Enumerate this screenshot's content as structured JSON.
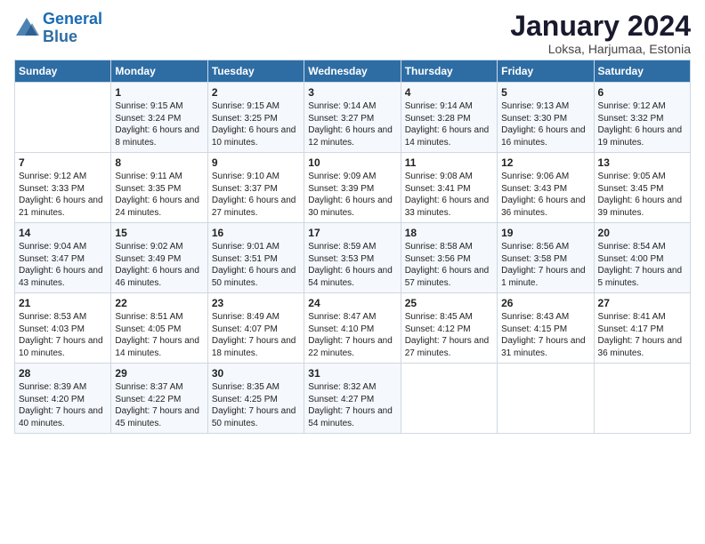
{
  "logo": {
    "line1": "General",
    "line2": "Blue"
  },
  "title": "January 2024",
  "subtitle": "Loksa, Harjumaa, Estonia",
  "days_of_week": [
    "Sunday",
    "Monday",
    "Tuesday",
    "Wednesday",
    "Thursday",
    "Friday",
    "Saturday"
  ],
  "weeks": [
    [
      {
        "day": "",
        "sunrise": "",
        "sunset": "",
        "daylight": ""
      },
      {
        "day": "1",
        "sunrise": "Sunrise: 9:15 AM",
        "sunset": "Sunset: 3:24 PM",
        "daylight": "Daylight: 6 hours and 8 minutes."
      },
      {
        "day": "2",
        "sunrise": "Sunrise: 9:15 AM",
        "sunset": "Sunset: 3:25 PM",
        "daylight": "Daylight: 6 hours and 10 minutes."
      },
      {
        "day": "3",
        "sunrise": "Sunrise: 9:14 AM",
        "sunset": "Sunset: 3:27 PM",
        "daylight": "Daylight: 6 hours and 12 minutes."
      },
      {
        "day": "4",
        "sunrise": "Sunrise: 9:14 AM",
        "sunset": "Sunset: 3:28 PM",
        "daylight": "Daylight: 6 hours and 14 minutes."
      },
      {
        "day": "5",
        "sunrise": "Sunrise: 9:13 AM",
        "sunset": "Sunset: 3:30 PM",
        "daylight": "Daylight: 6 hours and 16 minutes."
      },
      {
        "day": "6",
        "sunrise": "Sunrise: 9:12 AM",
        "sunset": "Sunset: 3:32 PM",
        "daylight": "Daylight: 6 hours and 19 minutes."
      }
    ],
    [
      {
        "day": "7",
        "sunrise": "Sunrise: 9:12 AM",
        "sunset": "Sunset: 3:33 PM",
        "daylight": "Daylight: 6 hours and 21 minutes."
      },
      {
        "day": "8",
        "sunrise": "Sunrise: 9:11 AM",
        "sunset": "Sunset: 3:35 PM",
        "daylight": "Daylight: 6 hours and 24 minutes."
      },
      {
        "day": "9",
        "sunrise": "Sunrise: 9:10 AM",
        "sunset": "Sunset: 3:37 PM",
        "daylight": "Daylight: 6 hours and 27 minutes."
      },
      {
        "day": "10",
        "sunrise": "Sunrise: 9:09 AM",
        "sunset": "Sunset: 3:39 PM",
        "daylight": "Daylight: 6 hours and 30 minutes."
      },
      {
        "day": "11",
        "sunrise": "Sunrise: 9:08 AM",
        "sunset": "Sunset: 3:41 PM",
        "daylight": "Daylight: 6 hours and 33 minutes."
      },
      {
        "day": "12",
        "sunrise": "Sunrise: 9:06 AM",
        "sunset": "Sunset: 3:43 PM",
        "daylight": "Daylight: 6 hours and 36 minutes."
      },
      {
        "day": "13",
        "sunrise": "Sunrise: 9:05 AM",
        "sunset": "Sunset: 3:45 PM",
        "daylight": "Daylight: 6 hours and 39 minutes."
      }
    ],
    [
      {
        "day": "14",
        "sunrise": "Sunrise: 9:04 AM",
        "sunset": "Sunset: 3:47 PM",
        "daylight": "Daylight: 6 hours and 43 minutes."
      },
      {
        "day": "15",
        "sunrise": "Sunrise: 9:02 AM",
        "sunset": "Sunset: 3:49 PM",
        "daylight": "Daylight: 6 hours and 46 minutes."
      },
      {
        "day": "16",
        "sunrise": "Sunrise: 9:01 AM",
        "sunset": "Sunset: 3:51 PM",
        "daylight": "Daylight: 6 hours and 50 minutes."
      },
      {
        "day": "17",
        "sunrise": "Sunrise: 8:59 AM",
        "sunset": "Sunset: 3:53 PM",
        "daylight": "Daylight: 6 hours and 54 minutes."
      },
      {
        "day": "18",
        "sunrise": "Sunrise: 8:58 AM",
        "sunset": "Sunset: 3:56 PM",
        "daylight": "Daylight: 6 hours and 57 minutes."
      },
      {
        "day": "19",
        "sunrise": "Sunrise: 8:56 AM",
        "sunset": "Sunset: 3:58 PM",
        "daylight": "Daylight: 7 hours and 1 minute."
      },
      {
        "day": "20",
        "sunrise": "Sunrise: 8:54 AM",
        "sunset": "Sunset: 4:00 PM",
        "daylight": "Daylight: 7 hours and 5 minutes."
      }
    ],
    [
      {
        "day": "21",
        "sunrise": "Sunrise: 8:53 AM",
        "sunset": "Sunset: 4:03 PM",
        "daylight": "Daylight: 7 hours and 10 minutes."
      },
      {
        "day": "22",
        "sunrise": "Sunrise: 8:51 AM",
        "sunset": "Sunset: 4:05 PM",
        "daylight": "Daylight: 7 hours and 14 minutes."
      },
      {
        "day": "23",
        "sunrise": "Sunrise: 8:49 AM",
        "sunset": "Sunset: 4:07 PM",
        "daylight": "Daylight: 7 hours and 18 minutes."
      },
      {
        "day": "24",
        "sunrise": "Sunrise: 8:47 AM",
        "sunset": "Sunset: 4:10 PM",
        "daylight": "Daylight: 7 hours and 22 minutes."
      },
      {
        "day": "25",
        "sunrise": "Sunrise: 8:45 AM",
        "sunset": "Sunset: 4:12 PM",
        "daylight": "Daylight: 7 hours and 27 minutes."
      },
      {
        "day": "26",
        "sunrise": "Sunrise: 8:43 AM",
        "sunset": "Sunset: 4:15 PM",
        "daylight": "Daylight: 7 hours and 31 minutes."
      },
      {
        "day": "27",
        "sunrise": "Sunrise: 8:41 AM",
        "sunset": "Sunset: 4:17 PM",
        "daylight": "Daylight: 7 hours and 36 minutes."
      }
    ],
    [
      {
        "day": "28",
        "sunrise": "Sunrise: 8:39 AM",
        "sunset": "Sunset: 4:20 PM",
        "daylight": "Daylight: 7 hours and 40 minutes."
      },
      {
        "day": "29",
        "sunrise": "Sunrise: 8:37 AM",
        "sunset": "Sunset: 4:22 PM",
        "daylight": "Daylight: 7 hours and 45 minutes."
      },
      {
        "day": "30",
        "sunrise": "Sunrise: 8:35 AM",
        "sunset": "Sunset: 4:25 PM",
        "daylight": "Daylight: 7 hours and 50 minutes."
      },
      {
        "day": "31",
        "sunrise": "Sunrise: 8:32 AM",
        "sunset": "Sunset: 4:27 PM",
        "daylight": "Daylight: 7 hours and 54 minutes."
      },
      {
        "day": "",
        "sunrise": "",
        "sunset": "",
        "daylight": ""
      },
      {
        "day": "",
        "sunrise": "",
        "sunset": "",
        "daylight": ""
      },
      {
        "day": "",
        "sunrise": "",
        "sunset": "",
        "daylight": ""
      }
    ]
  ]
}
